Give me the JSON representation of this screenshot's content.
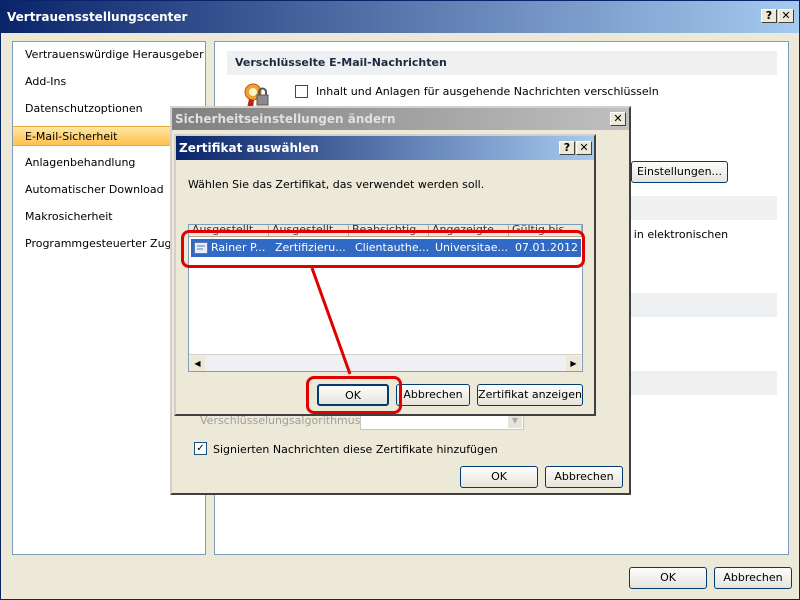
{
  "window": {
    "title": "Vertrauensstellungscenter",
    "help": "?",
    "close": "✕",
    "ok_label": "OK",
    "cancel_label": "Abbrechen"
  },
  "sidebar": {
    "items": [
      {
        "label": "Vertrauenswürdige Herausgeber"
      },
      {
        "label": "Add-Ins"
      },
      {
        "label": "Datenschutzoptionen"
      },
      {
        "label": "E-Mail-Sicherheit"
      },
      {
        "label": "Anlagenbehandlung"
      },
      {
        "label": "Automatischer Download"
      },
      {
        "label": "Makrosicherheit"
      },
      {
        "label": "Programmgesteuerter Zugriff"
      }
    ]
  },
  "content": {
    "section_title": "Verschlüsselte E-Mail-Nachrichten",
    "encrypt_label": "Inhalt und Anlagen für ausgehende Nachrichten verschlüsseln",
    "settings_button": "Einstellungen...",
    "partial_text": "t in elektronischen"
  },
  "security_dialog": {
    "title": "Sicherheitseinstellungen ändern",
    "close": "✕",
    "algorithm_label": "Verschlüsselungsalgorithmus:",
    "add_certs_label": "Signierten Nachrichten diese Zertifikate hinzufügen",
    "ok_label": "OK",
    "cancel_label": "Abbrechen"
  },
  "cert_dialog": {
    "title": "Zertifikat auswählen",
    "help": "?",
    "close": "✕",
    "instruction": "Wählen Sie das Zertifikat, das verwendet werden soll.",
    "columns": [
      "Ausgestellt ...",
      "Ausgestellt ...",
      "Beabsichtig...",
      "Angezeigte...",
      "Gültig bis"
    ],
    "rows": [
      [
        "Rainer P...",
        "Zertifizieru...",
        "Clientauthe...",
        "Universitae...",
        "07.01.2012"
      ]
    ],
    "ok_label": "OK",
    "cancel_label": "Abbrechen",
    "view_label": "Zertifikat anzeigen"
  },
  "colors": {
    "title_active": "#0a246a",
    "selection": "#316ac5",
    "annotation": "#e00000"
  }
}
